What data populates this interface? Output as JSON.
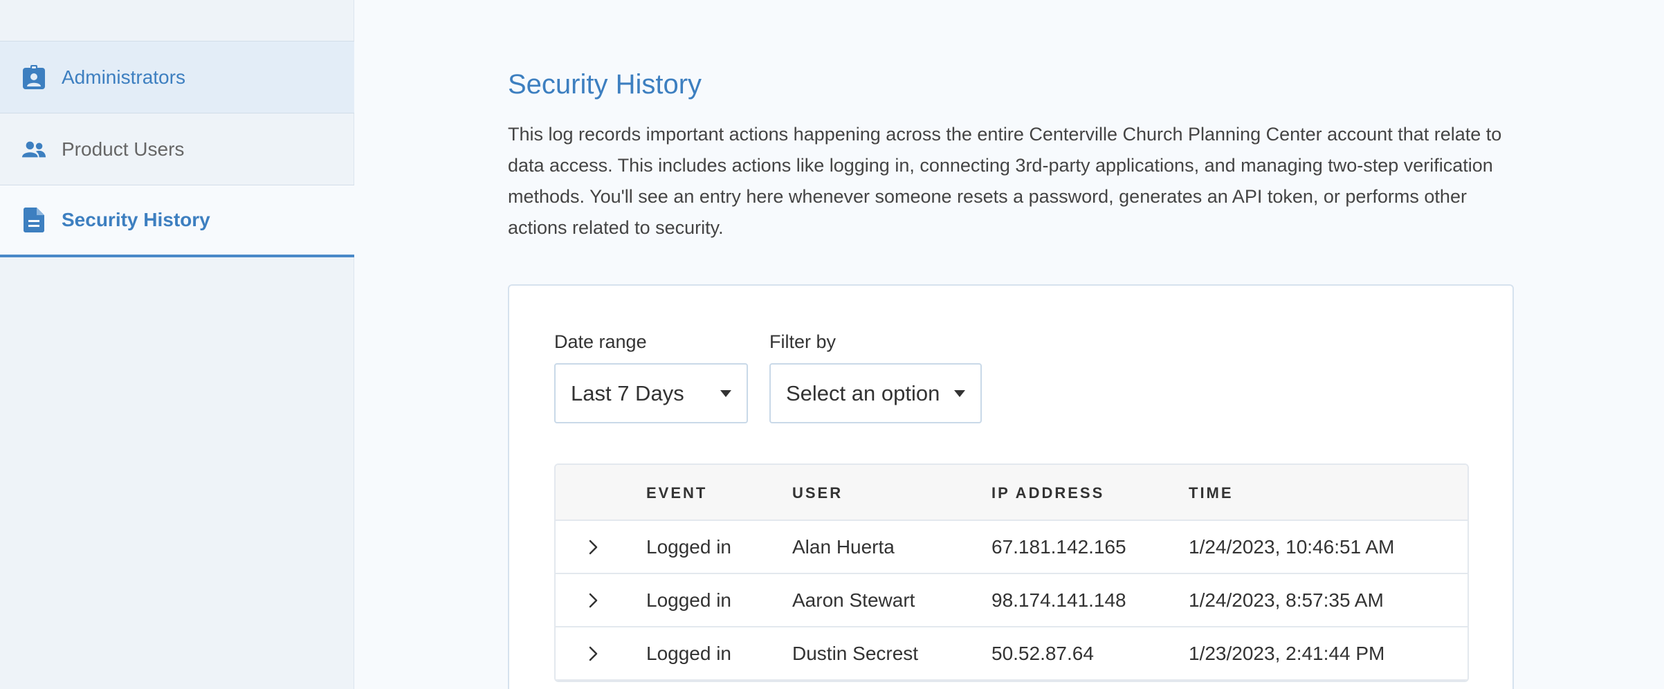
{
  "sidebar": {
    "items": [
      {
        "label": "Administrators",
        "icon": "id-badge-icon"
      },
      {
        "label": "Product Users",
        "icon": "users-icon"
      },
      {
        "label": "Security History",
        "icon": "document-icon"
      }
    ],
    "active_item": "Security History"
  },
  "main": {
    "title": "Security History",
    "description": "This log records important actions happening across the entire Centerville Church Planning Center account that relate to data access. This includes actions like logging in, connecting 3rd-party applications, and managing two-step verification methods. You'll see an entry here whenever someone resets a password, generates an API token, or performs other actions related to security."
  },
  "filters": {
    "date_range": {
      "label": "Date range",
      "value": "Last 7 Days"
    },
    "filter_by": {
      "label": "Filter by",
      "value": "Select an option"
    }
  },
  "table": {
    "headers": [
      "EVENT",
      "USER",
      "IP ADDRESS",
      "TIME"
    ],
    "rows": [
      {
        "event": "Logged in",
        "user": "Alan Huerta",
        "ip": "67.181.142.165",
        "time": "1/24/2023, 10:46:51 AM"
      },
      {
        "event": "Logged in",
        "user": "Aaron Stewart",
        "ip": "98.174.141.148",
        "time": "1/24/2023, 8:57:35 AM"
      },
      {
        "event": "Logged in",
        "user": "Dustin Secrest",
        "ip": "50.52.87.64",
        "time": "1/23/2023, 2:41:44 PM"
      }
    ]
  },
  "colors": {
    "accent": "#3d7fc0",
    "sidebar_bg": "#eef3f8",
    "page_bg": "#f7fafd"
  }
}
